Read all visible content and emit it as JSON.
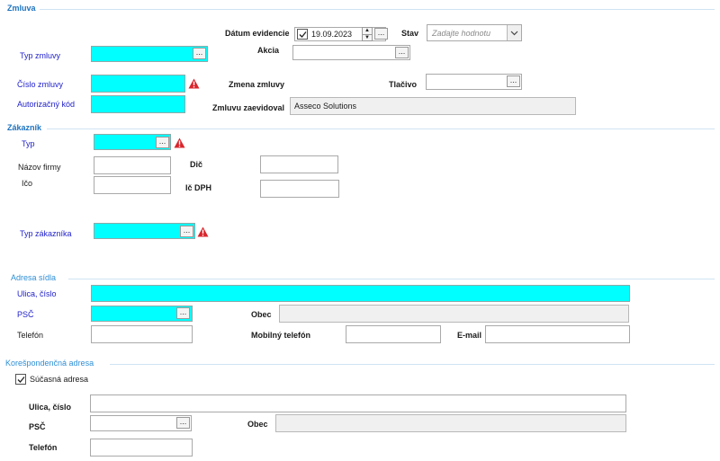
{
  "zmluva": {
    "title": "Zmluva",
    "datum_evidencie": {
      "label": "Dátum evidencie",
      "value": "19.09.2023",
      "checked": true
    },
    "stav": {
      "label": "Stav",
      "placeholder": "Zadajte hodnotu"
    },
    "typ_zmluvy": {
      "label": "Typ zmluvy",
      "value": ""
    },
    "akcia": {
      "label": "Akcia",
      "value": ""
    },
    "cislo_zmluvy": {
      "label": "Číslo zmluvy",
      "value": ""
    },
    "zmena_zmluvy": {
      "label": "Zmena zmluvy"
    },
    "tlacivo": {
      "label": "Tlačivo",
      "value": ""
    },
    "autorizacny_kod": {
      "label": "Autorizačný kód",
      "value": ""
    },
    "zmluvu_zaevidoval": {
      "label": "Zmluvu zaevidoval",
      "value": "Asseco Solutions"
    }
  },
  "zakaznik": {
    "title": "Zákazník",
    "typ": {
      "label": "Typ",
      "value": ""
    },
    "nazov_firmy": {
      "label": "Názov firmy",
      "value": ""
    },
    "dic": {
      "label": "Dič",
      "value": ""
    },
    "ico": {
      "label": "Ičo",
      "value": ""
    },
    "ic_dph": {
      "label": "Ič DPH",
      "value": ""
    },
    "typ_zakaznika": {
      "label": "Typ zákazníka",
      "value": ""
    }
  },
  "adresa_sidla": {
    "title": "Adresa sídla",
    "ulica": {
      "label": "Ulica, číslo",
      "value": ""
    },
    "psc": {
      "label": "PSČ",
      "value": ""
    },
    "obec": {
      "label": "Obec",
      "value": ""
    },
    "telefon": {
      "label": "Telefón",
      "value": ""
    },
    "mobilny": {
      "label": "Mobilný telefón",
      "value": ""
    },
    "email": {
      "label": "E-mail",
      "value": ""
    }
  },
  "korespondencna": {
    "title": "Korešpondenčná adresa",
    "sucasna": {
      "label": "Súčasná adresa",
      "checked": true
    },
    "ulica": {
      "label": "Ulica, číslo",
      "value": ""
    },
    "psc": {
      "label": "PSČ",
      "value": ""
    },
    "obec": {
      "label": "Obec",
      "value": ""
    },
    "telefon": {
      "label": "Telefón",
      "value": ""
    }
  },
  "ui": {
    "lookup_button": "...",
    "spin_up": "▲",
    "spin_down": "▼"
  },
  "colors": {
    "required_field": "#00ffff",
    "section_title": "#1e73be",
    "required_label": "#2222cc",
    "warning": "#d9252c"
  }
}
